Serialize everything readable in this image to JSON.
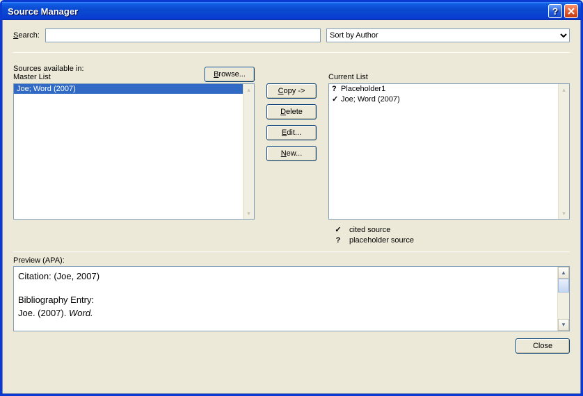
{
  "window": {
    "title": "Source Manager"
  },
  "search": {
    "label_pre": "S",
    "label_post": "earch:",
    "value": ""
  },
  "sort": {
    "selected": "Sort by Author"
  },
  "sourcesAvailable": {
    "label": "Sources available in:",
    "masterLabel": "Master List",
    "currentLabel": "Current List"
  },
  "masterList": [
    {
      "text": "Joe; Word (2007)",
      "selected": true
    }
  ],
  "currentList": [
    {
      "marker": "?",
      "text": "Placeholder1"
    },
    {
      "marker": "✓",
      "text": "Joe; Word (2007)"
    }
  ],
  "buttons": {
    "browse_pre": "B",
    "browse_post": "rowse...",
    "copy_pre": "C",
    "copy_post": "opy ->",
    "delete_pre": "D",
    "delete_post": "elete",
    "edit_pre": "E",
    "edit_post": "dit...",
    "new_pre": "N",
    "new_post": "ew...",
    "close": "Close"
  },
  "legend": {
    "cited": "cited source",
    "placeholder": "placeholder source"
  },
  "preview": {
    "label": "Preview (APA):",
    "citationLabel": "Citation: ",
    "citationValue": "(Joe, 2007)",
    "biblioLabel": "Bibliography Entry:",
    "biblioAuthorYear": "Joe. (2007). ",
    "biblioTitleItalic": "Word."
  }
}
